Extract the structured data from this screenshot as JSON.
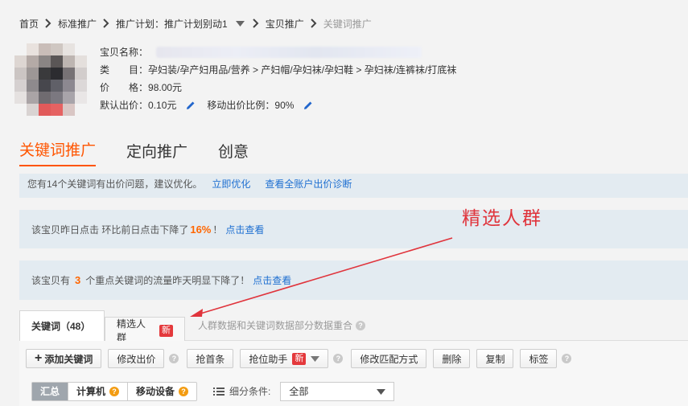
{
  "breadcrumb": {
    "items": [
      "首页",
      "标准推广",
      "推广计划：推广计划别动1",
      "宝贝推广",
      "关键词推广"
    ]
  },
  "product": {
    "name_label": "宝贝名称：",
    "category_label": "类　　目：",
    "category_value": "孕妇装/孕产妇用品/营养 > 产妇帽/孕妇袜/孕妇鞋 > 孕妇袜/连裤袜/打底袜",
    "price_label": "价　　格：",
    "price_value": "98.00元",
    "default_bid_label": "默认出价：",
    "default_bid_value": "0.10元",
    "mobile_ratio_label": "移动出价比例：",
    "mobile_ratio_value": "90%"
  },
  "top_tabs": [
    "关键词推广",
    "定向推广",
    "创意"
  ],
  "notices": {
    "n1_text": "您有14个关键词有出价问题，建议优化。",
    "n1_link1": "立即优化",
    "n1_link2": "查看全账户出价诊断",
    "n2_prefix": "该宝贝昨日点击 环比前日点击下降了",
    "n2_value": "16%",
    "n2_suffix": "！",
    "n2_link": "点击查看",
    "n3_prefix": "该宝贝有",
    "n3_value": "3",
    "n3_suffix": "个重点关键词的流量昨天明显下降了！",
    "n3_link": "点击查看"
  },
  "annotation": "精选人群",
  "panel_tabs": {
    "tab1": "关键词（48）",
    "tab2": "精选人群",
    "badge": "新",
    "desc": "人群数据和关键词数据部分数据重合"
  },
  "toolbar": {
    "add_keyword": "添加关键词",
    "edit_bid": "修改出价",
    "grab_top": "抢首条",
    "bid_assistant": "抢位助手",
    "badge": "新",
    "edit_match": "修改匹配方式",
    "delete": "删除",
    "copy": "复制",
    "tag": "标签"
  },
  "filter": {
    "seg_all": "汇总",
    "seg_pc": "计算机",
    "seg_mobile": "移动设备",
    "label": "细分条件:",
    "select_value": "全部"
  },
  "colors": {
    "accent": "#ff5500",
    "link": "#1e6fd1",
    "annotation": "#e0343c",
    "notice_bg": "#e3ebf1"
  }
}
